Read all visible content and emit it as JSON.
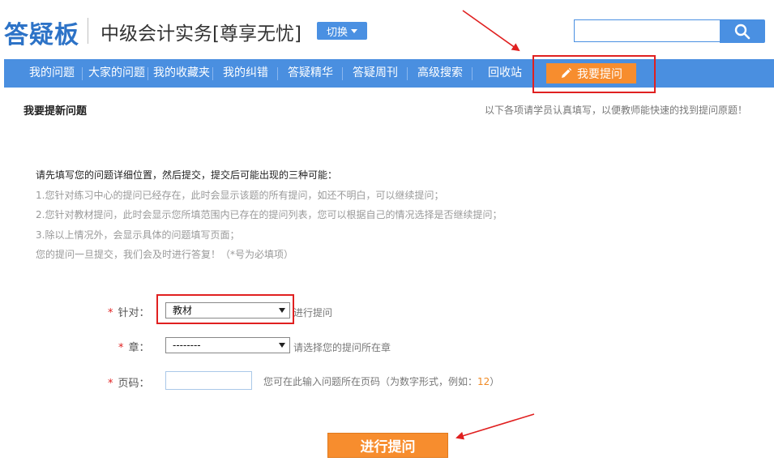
{
  "header": {
    "logo": "答疑板",
    "course_title": "中级会计实务[尊享无忧]",
    "switch_label": "切换",
    "search_value": ""
  },
  "nav": {
    "items": [
      {
        "label": "我的问题"
      },
      {
        "label": "大家的问题"
      },
      {
        "label": "我的收藏夹"
      },
      {
        "label": "我的纠错"
      },
      {
        "label": "答疑精华"
      },
      {
        "label": "答疑周刊"
      },
      {
        "label": "高级搜索"
      },
      {
        "label": "回收站"
      }
    ],
    "ask_label": "我要提问"
  },
  "section": {
    "title": "我要提新问题",
    "hint": "以下各项请学员认真填写，以便教师能快速的找到提问原题！"
  },
  "intro": [
    "请先填写您的问题详细位置，然后提交，提交后可能出现的三种可能：",
    "1.您针对练习中心的提问已经存在，此时会显示该题的所有提问，如还不明白，可以继续提问；",
    "2.您针对教材提问，此时会显示您所填范围内已存在的提问列表，您可以根据自己的情况选择是否继续提问；",
    "3.除以上情况外，会显示具体的问题填写页面；",
    "您的提问一旦提交，我们会及时进行答复！（*号为必填项）"
  ],
  "form": {
    "required_mark": "*",
    "target": {
      "label": "针对：",
      "selected": "教材",
      "hint": "进行提问"
    },
    "chapter": {
      "label": "章：",
      "selected": "--------",
      "hint": "请选择您的提问所在章"
    },
    "page": {
      "label": "页码：",
      "value": "",
      "hint": "您可在此输入问题所在页码（为数字形式，例如：",
      "example": "12",
      "hint_end": "）"
    }
  },
  "submit_label": "进行提问",
  "colors": {
    "accent": "#4a8fe0",
    "orange": "#f78d2e",
    "annotation_red": "#e02020"
  }
}
